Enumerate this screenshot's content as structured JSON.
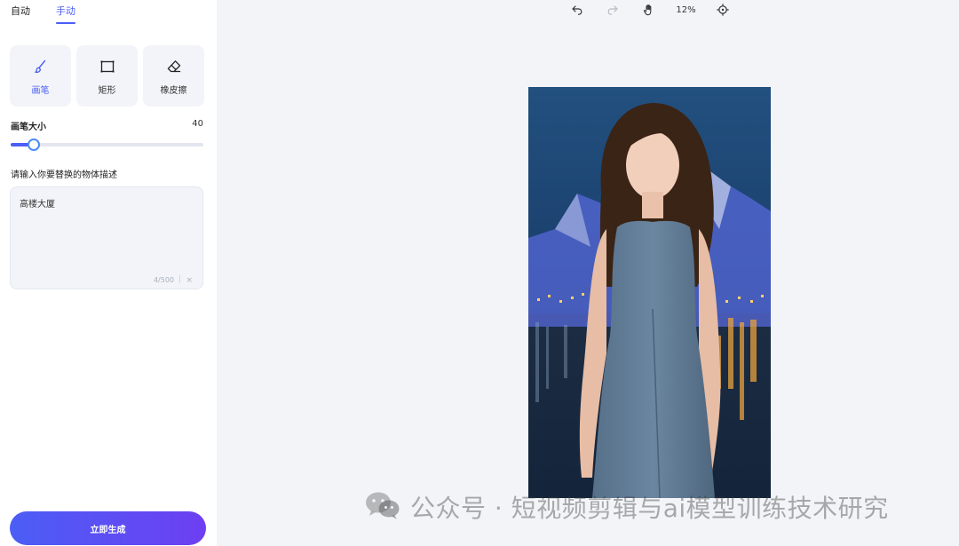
{
  "tabs": [
    {
      "label": "自动",
      "active": false
    },
    {
      "label": "手动",
      "active": true
    }
  ],
  "tools": [
    {
      "label": "画笔",
      "icon": "brush-icon",
      "active": true
    },
    {
      "label": "矩形",
      "icon": "rectangle-icon",
      "active": false
    },
    {
      "label": "橡皮擦",
      "icon": "eraser-icon",
      "active": false
    }
  ],
  "brush": {
    "title": "画笔大小",
    "value": "40",
    "slider_fraction": 0.12
  },
  "description": {
    "label": "请输入你要替换的物体描述",
    "value": "高楼大厦",
    "count": "4/500",
    "clear": "×"
  },
  "generate_button": "立即生成",
  "toolbar": {
    "zoom": "12%",
    "icons": [
      "undo-icon",
      "redo-icon",
      "hand-pan-icon",
      "crosshair-icon"
    ]
  },
  "watermark": {
    "text": "公众号 · 短视频剪辑与ai模型训练技术研究",
    "icon": "wechat-icon"
  },
  "colors": {
    "accent": "#4b5ef5",
    "accent_gradient_end": "#6d3ff2",
    "panel_bg": "#ffffff",
    "canvas_bg": "#f3f4f8"
  }
}
